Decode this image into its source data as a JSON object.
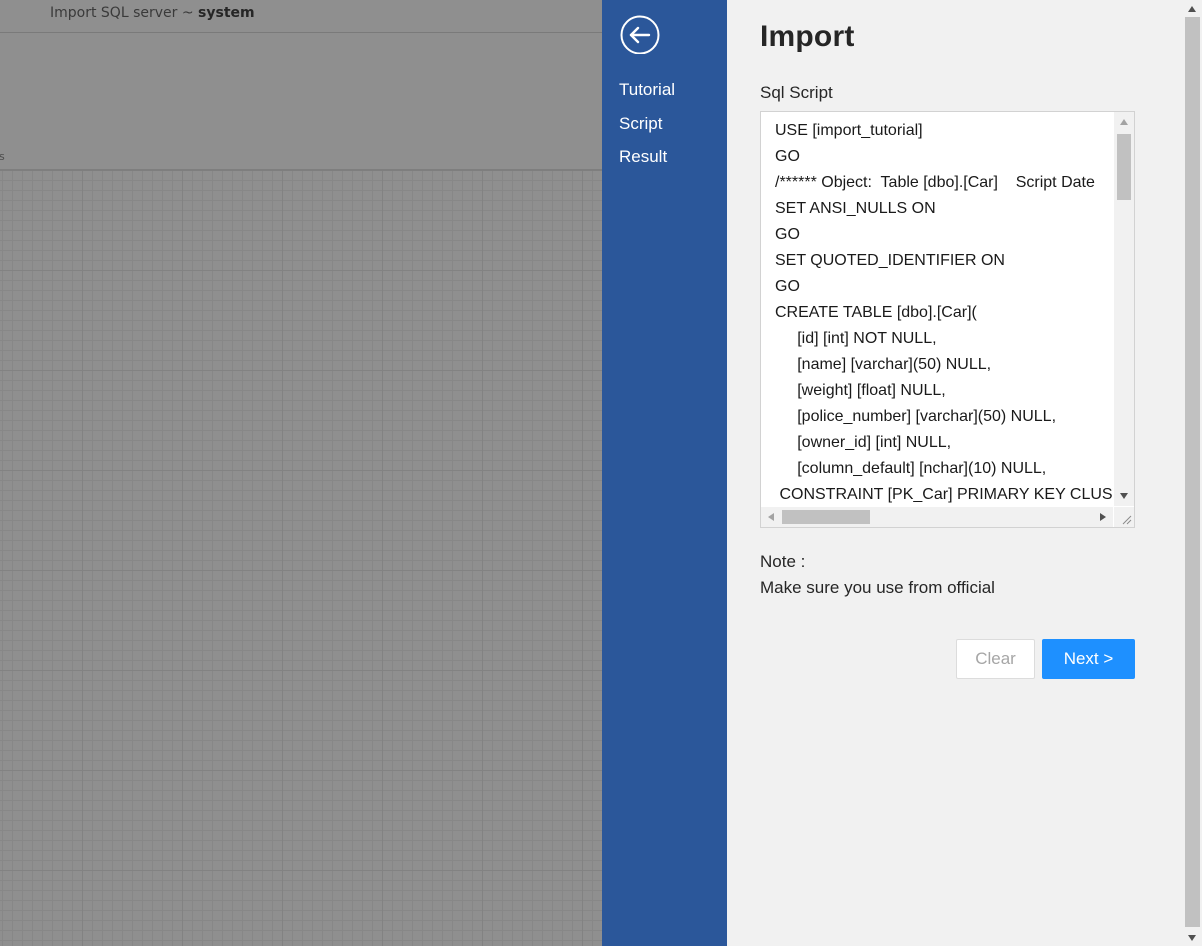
{
  "background_app": {
    "title_prefix": "Import SQL server ~ ",
    "title_db": "system",
    "toolbar_fragment": "ds"
  },
  "nav": {
    "back_icon": "circle-arrow-left-icon",
    "items": [
      {
        "label": "Tutorial"
      },
      {
        "label": "Script"
      },
      {
        "label": "Result"
      }
    ]
  },
  "panel": {
    "title": "Import",
    "script_label": "Sql Script",
    "script_lines": [
      "USE [import_tutorial]",
      "GO",
      "/****** Object:  Table [dbo].[Car]    Script Date",
      "SET ANSI_NULLS ON",
      "GO",
      "SET QUOTED_IDENTIFIER ON",
      "GO",
      "CREATE TABLE [dbo].[Car](",
      "\t[id] [int] NOT NULL,",
      "\t[name] [varchar](50) NULL,",
      "\t[weight] [float] NULL,",
      "\t[police_number] [varchar](50) NULL,",
      "\t[owner_id] [int] NULL,",
      "\t[column_default] [nchar](10) NULL,",
      " CONSTRAINT [PK_Car] PRIMARY KEY CLUSTERED"
    ],
    "note_label": "Note :",
    "note_text": "Make sure you use from official",
    "clear_label": "Clear",
    "next_label": "Next >"
  },
  "colors": {
    "nav_bg": "#2b579a",
    "panel_bg": "#f1f1f1",
    "primary_button": "#1e90ff",
    "overlay": "#8f8f8f"
  }
}
